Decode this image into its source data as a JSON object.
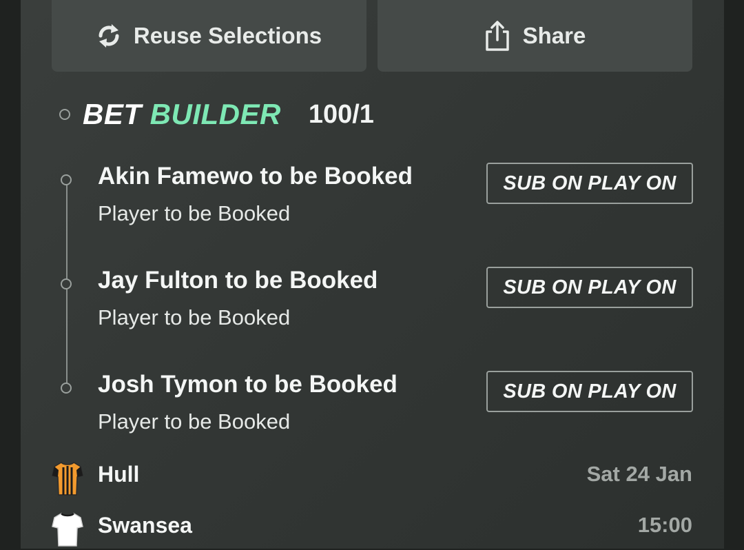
{
  "actions": {
    "reuse_label": "Reuse Selections",
    "share_label": "Share"
  },
  "bet_builder": {
    "title_part1": "BET",
    "title_part2": "BUILDER",
    "odds": "100/1",
    "accent_color": "#7ee8b4"
  },
  "selections": [
    {
      "title": "Akin Famewo to be Booked",
      "market": "Player to be Booked",
      "badge": "SUB ON PLAY ON"
    },
    {
      "title": "Jay Fulton to be Booked",
      "market": "Player to be Booked",
      "badge": "SUB ON PLAY ON"
    },
    {
      "title": "Josh Tymon to be Booked",
      "market": "Player to be Booked",
      "badge": "SUB ON PLAY ON"
    }
  ],
  "match": {
    "home_team": "Hull",
    "away_team": "Swansea",
    "date": "Sat 24 Jan",
    "time": "15:00"
  },
  "icons": {
    "reuse": "refresh-icon",
    "share": "share-icon",
    "home_kit": "hull-kit-icon",
    "away_kit": "swansea-kit-icon"
  }
}
